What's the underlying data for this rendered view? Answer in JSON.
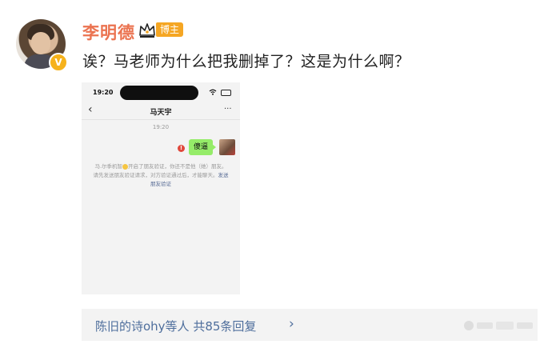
{
  "post": {
    "username": "李明德",
    "badge_tag": "博主",
    "verified_mark": "V",
    "text": "诶？马老师为什么把我删掉了？这是为什么啊？"
  },
  "icons": {
    "crown": "crown-icon",
    "verified": "verified-badge-icon",
    "chevron": "chevron-right-icon"
  },
  "colors": {
    "username": "#eb7350",
    "tag_bg": "#f5a623",
    "link": "#4e6e9c",
    "bubble": "#95ec69",
    "warn": "#e0473b"
  },
  "screenshot": {
    "status_time": "19:20",
    "back_glyph": "‹",
    "chat_title": "马天宇",
    "more_glyph": "···",
    "timestamp": "19:20",
    "warn_glyph": "!",
    "bubble_text": "傻逼",
    "system_message_1": "马.尔季机智",
    "system_message_2": "开启了朋友验证，你还不是他（她）朋友。请先发送朋友验证请求，对方验证通过后，才能聊天。",
    "system_link": "发送朋友验证"
  },
  "replies": {
    "text": "陈旧的诗ohy等人  共85条回复",
    "chevron": "›"
  }
}
